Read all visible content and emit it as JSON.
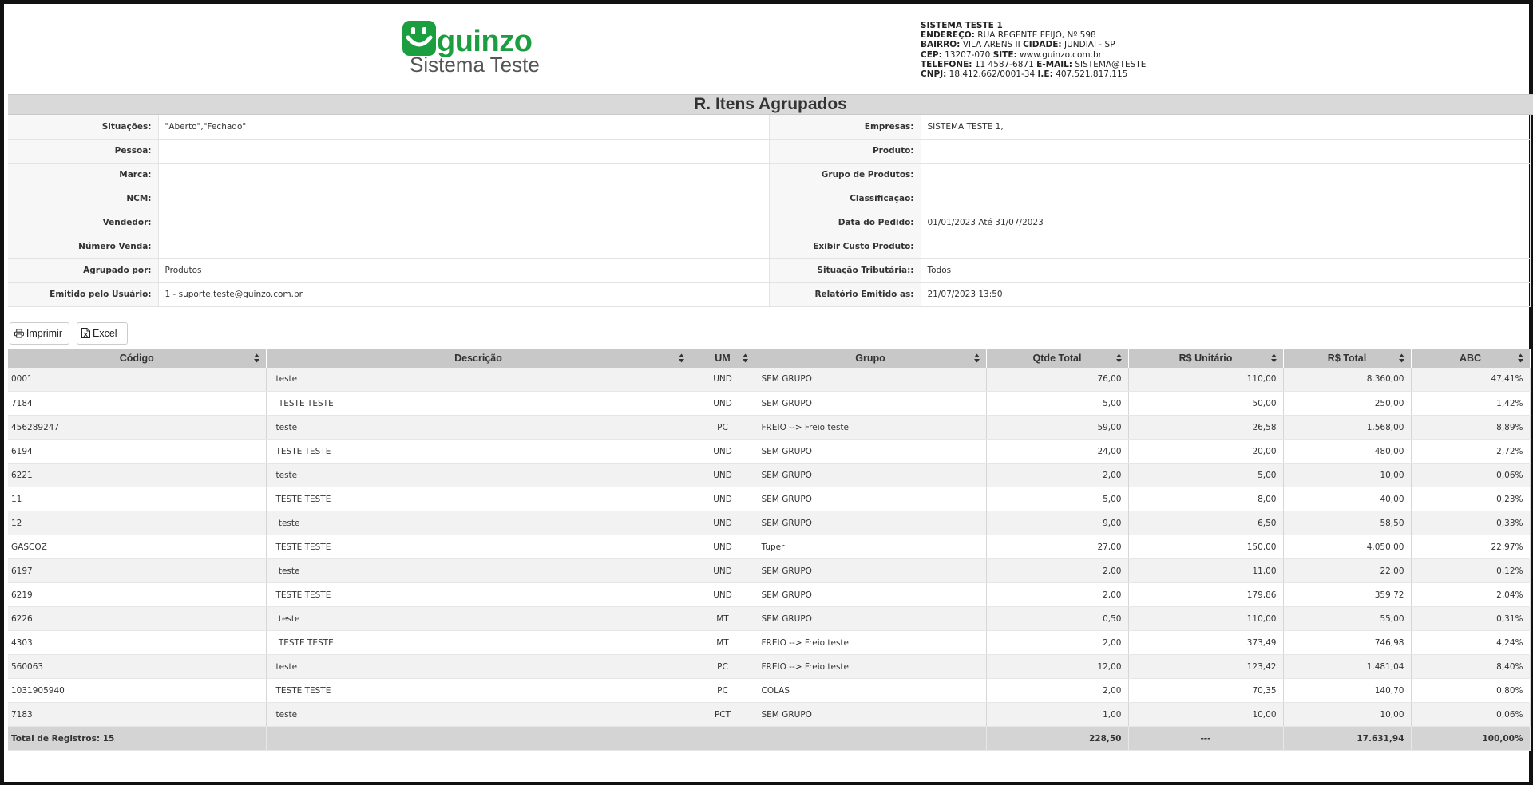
{
  "brand": {
    "name": "guinzo",
    "subtitle": "Sistema Teste",
    "color": "#1a9e3f"
  },
  "company": {
    "name": "SISTEMA TESTE 1",
    "endereco_label": "ENDEREÇO:",
    "endereco": "RUA REGENTE FEIJO, Nº 598",
    "bairro_label": "BAIRRO:",
    "bairro": "VILA ARENS II",
    "cidade_label": "CIDADE:",
    "cidade": "JUNDIAI - SP",
    "cep_label": "CEP:",
    "cep": "13207-070",
    "site_label": "SITE:",
    "site": "www.guinzo.com.br",
    "telefone_label": "TELEFONE:",
    "telefone": "11 4587-6871",
    "email_label": "E-MAIL:",
    "email": "SISTEMA@TESTE",
    "cnpj_label": "CNPJ:",
    "cnpj": "18.412.662/0001-34",
    "ie_label": "I.E:",
    "ie": "407.521.817.115"
  },
  "report_title": "R. Itens Agrupados",
  "filters": [
    {
      "label_left": "Situações:",
      "value_left": "\"Aberto\",\"Fechado\"",
      "label_right": "Empresas:",
      "value_right": "SISTEMA TESTE 1,"
    },
    {
      "label_left": "Pessoa:",
      "value_left": "",
      "label_right": "Produto:",
      "value_right": ""
    },
    {
      "label_left": "Marca:",
      "value_left": "",
      "label_right": "Grupo de Produtos:",
      "value_right": ""
    },
    {
      "label_left": "NCM:",
      "value_left": "",
      "label_right": "Classificação:",
      "value_right": ""
    },
    {
      "label_left": "Vendedor:",
      "value_left": "",
      "label_right": "Data do Pedido:",
      "value_right": "01/01/2023 Até 31/07/2023"
    },
    {
      "label_left": "Número Venda:",
      "value_left": "",
      "label_right": "Exibir Custo Produto:",
      "value_right": ""
    },
    {
      "label_left": "Agrupado por:",
      "value_left": "Produtos",
      "label_right": "Situação Tributária::",
      "value_right": "Todos"
    },
    {
      "label_left": "Emitido pelo Usuário:",
      "value_left": "1 - suporte.teste@guinzo.com.br",
      "label_right": "Relatório Emitido as:",
      "value_right": "21/07/2023 13:50"
    }
  ],
  "toolbar": {
    "print_label": "Imprimir",
    "excel_label": "Excel"
  },
  "table": {
    "columns": [
      "Código",
      "Descrição",
      "UM",
      "Grupo",
      "Qtde Total",
      "R$ Unitário",
      "R$ Total",
      "ABC"
    ],
    "rows": [
      [
        "0001",
        "teste",
        "UND",
        "SEM GRUPO",
        "76,00",
        "110,00",
        "8.360,00",
        "47,41%"
      ],
      [
        "7184",
        " TESTE TESTE",
        "UND",
        "SEM GRUPO",
        "5,00",
        "50,00",
        "250,00",
        "1,42%"
      ],
      [
        "456289247",
        "teste",
        "PC",
        "FREIO --> Freio teste",
        "59,00",
        "26,58",
        "1.568,00",
        "8,89%"
      ],
      [
        "6194",
        "TESTE TESTE",
        "UND",
        "SEM GRUPO",
        "24,00",
        "20,00",
        "480,00",
        "2,72%"
      ],
      [
        "6221",
        "teste",
        "UND",
        "SEM GRUPO",
        "2,00",
        "5,00",
        "10,00",
        "0,06%"
      ],
      [
        "11",
        "TESTE TESTE",
        "UND",
        "SEM GRUPO",
        "5,00",
        "8,00",
        "40,00",
        "0,23%"
      ],
      [
        "12",
        " teste",
        "UND",
        "SEM GRUPO",
        "9,00",
        "6,50",
        "58,50",
        "0,33%"
      ],
      [
        "GASCOZ",
        "TESTE TESTE",
        "UND",
        "Tuper",
        "27,00",
        "150,00",
        "4.050,00",
        "22,97%"
      ],
      [
        "6197",
        " teste",
        "UND",
        "SEM GRUPO",
        "2,00",
        "11,00",
        "22,00",
        "0,12%"
      ],
      [
        "6219",
        "TESTE TESTE",
        "UND",
        "SEM GRUPO",
        "2,00",
        "179,86",
        "359,72",
        "2,04%"
      ],
      [
        "6226",
        " teste",
        "MT",
        "SEM GRUPO",
        "0,50",
        "110,00",
        "55,00",
        "0,31%"
      ],
      [
        "4303",
        " TESTE TESTE",
        "MT",
        "FREIO --> Freio teste",
        "2,00",
        "373,49",
        "746,98",
        "4,24%"
      ],
      [
        "560063",
        "teste",
        "PC",
        "FREIO --> Freio teste",
        "12,00",
        "123,42",
        "1.481,04",
        "8,40%"
      ],
      [
        "1031905940",
        "TESTE TESTE",
        "PC",
        "COLAS",
        "2,00",
        "70,35",
        "140,70",
        "0,80%"
      ],
      [
        "7183",
        "teste",
        "PCT",
        "SEM GRUPO",
        "1,00",
        "10,00",
        "10,00",
        "0,06%"
      ]
    ],
    "total": {
      "label": "Total de Registros: 15",
      "qtde": "228,50",
      "unitario": "---",
      "total": "17.631,94",
      "abc": "100,00%"
    }
  }
}
